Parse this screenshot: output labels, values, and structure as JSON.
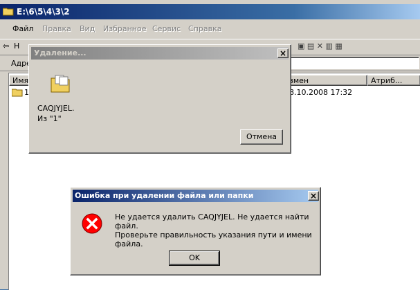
{
  "explorer": {
    "title": "E:\\6\\5\\4\\3\\2",
    "menu": [
      "Файл",
      "Правка",
      "Вид",
      "Избранное",
      "Сервис",
      "Справка"
    ],
    "toolbar_back": "Н",
    "address_label": "Адре",
    "columns": {
      "name": "Имя",
      "modified": "змен",
      "attributes": "Атриб..."
    },
    "rows": [
      {
        "name": "1",
        "modified": "8.10.2008 17:32"
      }
    ]
  },
  "delete_dialog": {
    "title": "Удаление...",
    "file_name": "CAQJYJEL.",
    "from": "Из \"1\"",
    "cancel_label": "Отмена",
    "close_glyph": "×"
  },
  "error_dialog": {
    "title": "Ошибка при удалении файла или папки",
    "message": "Не удается удалить CAQJYJEL. Не удается найти файл.",
    "hint": "Проверьте правильность указания пути и имени файла.",
    "ok_label": "OK",
    "close_glyph": "×"
  },
  "colors": {
    "active_title": "#0a246a",
    "inactive_title": "#808080",
    "face": "#d4d0c8",
    "error_icon": "#ff0000"
  },
  "icons": [
    "folder-icon",
    "flying-papers-icon",
    "error-icon",
    "back-arrow-icon",
    "close-icon"
  ]
}
